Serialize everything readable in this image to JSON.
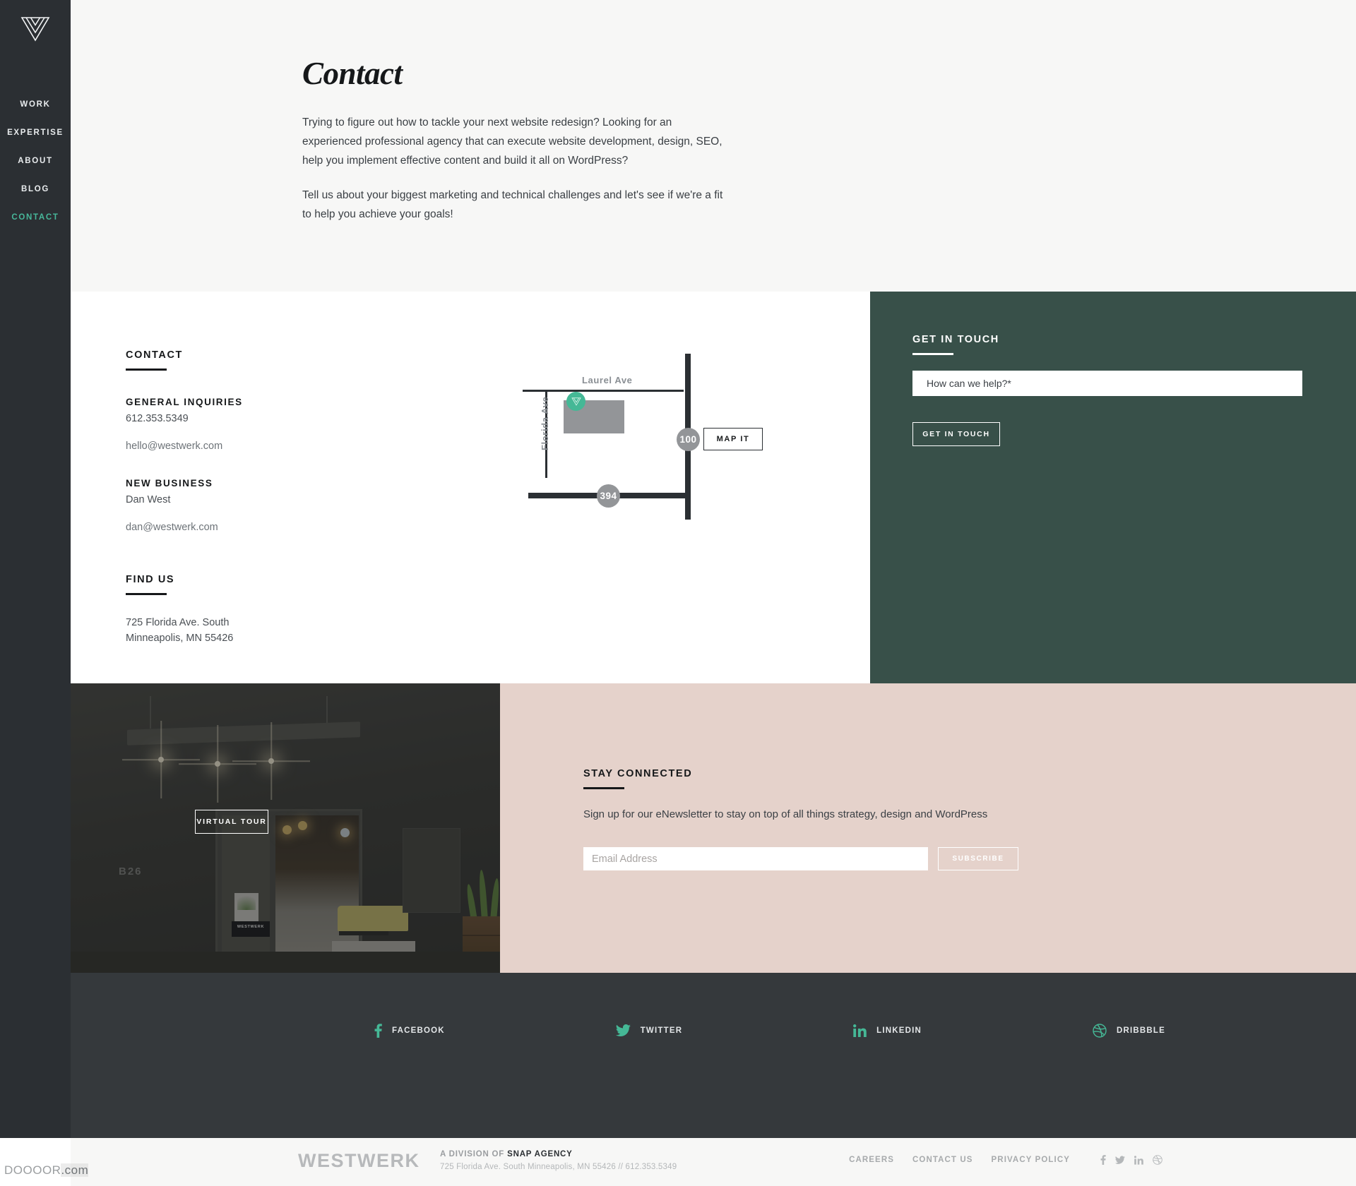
{
  "brand": {
    "logo_icon": "westwerk-w-logo",
    "name": "WESTWERK"
  },
  "sidebar": {
    "items": [
      {
        "label": "WORK",
        "active": false
      },
      {
        "label": "EXPERTISE",
        "active": false
      },
      {
        "label": "ABOUT",
        "active": false
      },
      {
        "label": "BLOG",
        "active": false
      },
      {
        "label": "CONTACT",
        "active": true
      }
    ],
    "active_color": "#47b79a",
    "background": "#2b2f33"
  },
  "hero": {
    "title": "Contact",
    "paragraph_1": "Trying to figure out how to tackle your next website redesign? Looking for an experienced professional agency that can execute website development, design, SEO, help you implement effective content and build it all on WordPress?",
    "paragraph_2": "Tell us about your biggest marketing and technical challenges and let's see if we're a fit to help you achieve your goals!",
    "background": "#f7f7f6"
  },
  "contact": {
    "heading": "CONTACT",
    "general_label": "GENERAL INQUIRIES",
    "general_phone": "612.353.5349",
    "general_email": "hello@westwerk.com",
    "new_business_label": "NEW BUSINESS",
    "new_business_name": "Dan West",
    "new_business_email": "dan@westwerk.com",
    "find_us_heading": "FIND US",
    "address_line_1": "725 Florida Ave. South",
    "address_line_2": "Minneapolis, MN 55426"
  },
  "map": {
    "street_horizontal": "Laurel Ave",
    "street_vertical": "Florida Ave",
    "highway_vertical": "100",
    "highway_horizontal": "394",
    "map_it_label": "MAP IT",
    "pin_icon": "westwerk-map-pin",
    "pin_color": "#45b896",
    "building_color": "#939598",
    "road_color": "#2b2f33"
  },
  "get_in_touch": {
    "heading": "GET IN TOUCH",
    "input_placeholder": "How can we help?*",
    "input_value": "",
    "button_label": "GET IN TOUCH",
    "background": "#385049"
  },
  "photo": {
    "tour_button_label": "VIRTUAL TOUR",
    "door_number": "B26",
    "office_sign": "WESTWERK"
  },
  "newsletter": {
    "heading": "STAY CONNECTED",
    "description": "Sign up for our eNewsletter to stay on top of all things strategy, design and WordPress",
    "input_placeholder": "Email Address",
    "input_value": "",
    "button_label": "SUBSCRIBE",
    "background": "#e5d2cb"
  },
  "social_bar": {
    "background": "#35393c",
    "icon_color": "#45b896",
    "items": [
      {
        "label": "FACEBOOK",
        "icon": "facebook-icon"
      },
      {
        "label": "TWITTER",
        "icon": "twitter-icon"
      },
      {
        "label": "LINKEDIN",
        "icon": "linkedin-icon"
      },
      {
        "label": "DRIBBBLE",
        "icon": "dribbble-icon"
      }
    ]
  },
  "footer": {
    "brand": "WESTWERK",
    "division_prefix": "A DIVISION OF ",
    "division_name": "SNAP AGENCY",
    "address_line": "725 Florida Ave. South Minneapolis, MN 55426 // 612.353.5349",
    "links": [
      {
        "label": "CAREERS"
      },
      {
        "label": "CONTACT US"
      },
      {
        "label": "PRIVACY POLICY"
      }
    ],
    "socials": [
      {
        "icon": "facebook-icon"
      },
      {
        "icon": "twitter-icon"
      },
      {
        "icon": "linkedin-icon"
      },
      {
        "icon": "dribbble-icon"
      }
    ]
  },
  "watermark": {
    "name": "DOOOOR",
    "suffix": ".com"
  }
}
